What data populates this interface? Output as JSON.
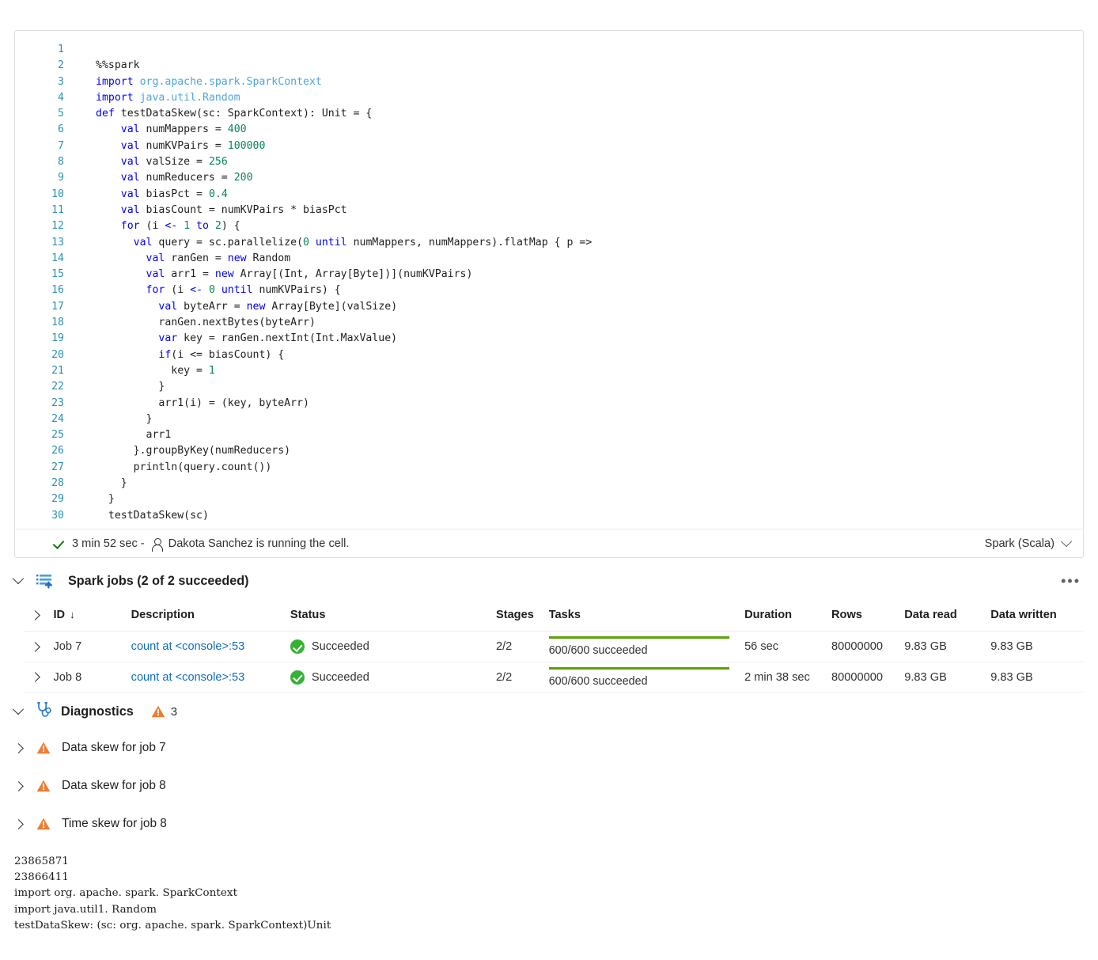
{
  "cell": {
    "language": "Spark (Scala)",
    "status": {
      "duration": "3 min 52 sec -",
      "user_message": "Dakota Sanchez is running the cell."
    },
    "code_lines": [
      {
        "n": "1",
        "tokens": []
      },
      {
        "n": "2",
        "tokens": [
          {
            "t": "%%spark",
            "c": "pln"
          }
        ]
      },
      {
        "n": "3",
        "tokens": [
          {
            "t": "import ",
            "c": "kw"
          },
          {
            "t": "org.apache.spark.SparkContext",
            "c": "pkg"
          }
        ]
      },
      {
        "n": "4",
        "tokens": [
          {
            "t": "import ",
            "c": "kw"
          },
          {
            "t": "java.util.Random",
            "c": "pkg"
          }
        ]
      },
      {
        "n": "5",
        "tokens": [
          {
            "t": "def ",
            "c": "kw"
          },
          {
            "t": "testDataSkew(sc: SparkContext): Unit = {",
            "c": "pln"
          }
        ]
      },
      {
        "n": "6",
        "tokens": [
          {
            "t": "    ",
            "c": "pln"
          },
          {
            "t": "val ",
            "c": "kw"
          },
          {
            "t": "numMappers = ",
            "c": "pln"
          },
          {
            "t": "400",
            "c": "num"
          }
        ]
      },
      {
        "n": "7",
        "tokens": [
          {
            "t": "    ",
            "c": "pln"
          },
          {
            "t": "val ",
            "c": "kw"
          },
          {
            "t": "numKVPairs = ",
            "c": "pln"
          },
          {
            "t": "100000",
            "c": "num"
          }
        ]
      },
      {
        "n": "8",
        "tokens": [
          {
            "t": "    ",
            "c": "pln"
          },
          {
            "t": "val ",
            "c": "kw"
          },
          {
            "t": "valSize = ",
            "c": "pln"
          },
          {
            "t": "256",
            "c": "num"
          }
        ]
      },
      {
        "n": "9",
        "tokens": [
          {
            "t": "    ",
            "c": "pln"
          },
          {
            "t": "val ",
            "c": "kw"
          },
          {
            "t": "numReducers = ",
            "c": "pln"
          },
          {
            "t": "200",
            "c": "num"
          }
        ]
      },
      {
        "n": "10",
        "tokens": [
          {
            "t": "    ",
            "c": "pln"
          },
          {
            "t": "val ",
            "c": "kw"
          },
          {
            "t": "biasPct = ",
            "c": "pln"
          },
          {
            "t": "0.4",
            "c": "num"
          }
        ]
      },
      {
        "n": "11",
        "tokens": [
          {
            "t": "    ",
            "c": "pln"
          },
          {
            "t": "val ",
            "c": "kw"
          },
          {
            "t": "biasCount = numKVPairs * biasPct",
            "c": "pln"
          }
        ]
      },
      {
        "n": "12",
        "tokens": [
          {
            "t": "    ",
            "c": "pln"
          },
          {
            "t": "for ",
            "c": "kw"
          },
          {
            "t": "(i ",
            "c": "pln"
          },
          {
            "t": "<- ",
            "c": "kw"
          },
          {
            "t": "1",
            "c": "num"
          },
          {
            "t": " to ",
            "c": "kw"
          },
          {
            "t": "2",
            "c": "num"
          },
          {
            "t": ") {",
            "c": "pln"
          }
        ]
      },
      {
        "n": "13",
        "tokens": [
          {
            "t": "      ",
            "c": "pln"
          },
          {
            "t": "val ",
            "c": "kw"
          },
          {
            "t": "query = sc.parallelize(",
            "c": "pln"
          },
          {
            "t": "0",
            "c": "num"
          },
          {
            "t": " until ",
            "c": "kw"
          },
          {
            "t": "numMappers, numMappers).flatMap { p =>",
            "c": "pln"
          }
        ]
      },
      {
        "n": "14",
        "tokens": [
          {
            "t": "        ",
            "c": "pln"
          },
          {
            "t": "val ",
            "c": "kw"
          },
          {
            "t": "ranGen = ",
            "c": "pln"
          },
          {
            "t": "new ",
            "c": "kw"
          },
          {
            "t": "Random",
            "c": "pln"
          }
        ]
      },
      {
        "n": "15",
        "tokens": [
          {
            "t": "        ",
            "c": "pln"
          },
          {
            "t": "val ",
            "c": "kw"
          },
          {
            "t": "arr1 = ",
            "c": "pln"
          },
          {
            "t": "new ",
            "c": "kw"
          },
          {
            "t": "Array[(Int, Array[Byte])](numKVPairs)",
            "c": "pln"
          }
        ]
      },
      {
        "n": "16",
        "tokens": [
          {
            "t": "        ",
            "c": "pln"
          },
          {
            "t": "for ",
            "c": "kw"
          },
          {
            "t": "(i ",
            "c": "pln"
          },
          {
            "t": "<- ",
            "c": "kw"
          },
          {
            "t": "0",
            "c": "num"
          },
          {
            "t": " until ",
            "c": "kw"
          },
          {
            "t": "numKVPairs) {",
            "c": "pln"
          }
        ]
      },
      {
        "n": "17",
        "tokens": [
          {
            "t": "          ",
            "c": "pln"
          },
          {
            "t": "val ",
            "c": "kw"
          },
          {
            "t": "byteArr = ",
            "c": "pln"
          },
          {
            "t": "new ",
            "c": "kw"
          },
          {
            "t": "Array[Byte](valSize)",
            "c": "pln"
          }
        ]
      },
      {
        "n": "18",
        "tokens": [
          {
            "t": "          ranGen.nextBytes(byteArr)",
            "c": "pln"
          }
        ]
      },
      {
        "n": "19",
        "tokens": [
          {
            "t": "          ",
            "c": "pln"
          },
          {
            "t": "var ",
            "c": "kw"
          },
          {
            "t": "key = ranGen.nextInt(Int.MaxValue)",
            "c": "pln"
          }
        ]
      },
      {
        "n": "20",
        "tokens": [
          {
            "t": "          ",
            "c": "pln"
          },
          {
            "t": "if",
            "c": "kw"
          },
          {
            "t": "(i <= biasCount) {",
            "c": "pln"
          }
        ]
      },
      {
        "n": "21",
        "tokens": [
          {
            "t": "            key = ",
            "c": "pln"
          },
          {
            "t": "1",
            "c": "num"
          }
        ]
      },
      {
        "n": "22",
        "tokens": [
          {
            "t": "          }",
            "c": "pln"
          }
        ]
      },
      {
        "n": "23",
        "tokens": [
          {
            "t": "          arr1(i) = (key, byteArr)",
            "c": "pln"
          }
        ]
      },
      {
        "n": "24",
        "tokens": [
          {
            "t": "        }",
            "c": "pln"
          }
        ]
      },
      {
        "n": "25",
        "tokens": [
          {
            "t": "        arr1",
            "c": "pln"
          }
        ]
      },
      {
        "n": "26",
        "tokens": [
          {
            "t": "      }.groupByKey(numReducers)",
            "c": "pln"
          }
        ]
      },
      {
        "n": "27",
        "tokens": [
          {
            "t": "      println(query.count())",
            "c": "pln"
          }
        ]
      },
      {
        "n": "28",
        "tokens": [
          {
            "t": "    }",
            "c": "pln"
          }
        ]
      },
      {
        "n": "29",
        "tokens": [
          {
            "t": "  }",
            "c": "pln"
          }
        ]
      },
      {
        "n": "30",
        "tokens": [
          {
            "t": "  testDataSkew(sc)",
            "c": "pln"
          }
        ]
      }
    ]
  },
  "spark_jobs": {
    "title": "Spark jobs (2 of 2 succeeded)",
    "columns": [
      "ID",
      "Description",
      "Status",
      "Stages",
      "Tasks",
      "Duration",
      "Rows",
      "Data read",
      "Data written"
    ],
    "sort_indicator": "↓",
    "rows": [
      {
        "id": "Job 7",
        "description": "count at <console>:53",
        "status": "Succeeded",
        "stages": "2/2",
        "tasks": "600/600 succeeded",
        "tasks_progress": 100,
        "duration": "56 sec",
        "rows": "80000000",
        "data_read": "9.83 GB",
        "data_written": "9.83 GB"
      },
      {
        "id": "Job 8",
        "description": "count at <console>:53",
        "status": "Succeeded",
        "stages": "2/2",
        "tasks": "600/600 succeeded",
        "tasks_progress": 100,
        "duration": "2 min 38 sec",
        "rows": "80000000",
        "data_read": "9.83 GB",
        "data_written": "9.83 GB"
      }
    ]
  },
  "diagnostics": {
    "title": "Diagnostics",
    "warning_count": "3",
    "items": [
      {
        "label": "Data skew for job 7"
      },
      {
        "label": "Data skew for job 8"
      },
      {
        "label": "Time skew for job 8"
      }
    ]
  },
  "console_output": "23865871\n23866411\nimport org. apache. spark. SparkContext\nimport java.util1. Random\ntestDataSkew: (sc: org. apache. spark. SparkContext)Unit",
  "colors": {
    "keyword": "#0000ff",
    "package": "#4ca5dd",
    "number": "#098658",
    "link": "#0f6cbd",
    "success": "#35b234",
    "warning": "#ed7d31",
    "progress": "#5aa305"
  }
}
